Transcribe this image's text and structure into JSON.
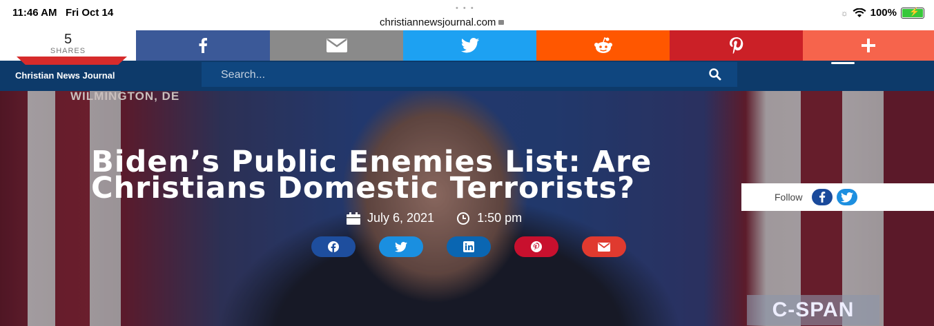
{
  "status": {
    "time": "11:46 AM",
    "day": "Fri Oct 14",
    "url": "christiannewsjournal.com",
    "battery": "100%",
    "dots": "• • •"
  },
  "sharebar": {
    "count": "5",
    "count_label": "SHARES",
    "buttons": [
      {
        "name": "facebook",
        "icon": "facebook-icon",
        "color": "#3b5998"
      },
      {
        "name": "email",
        "icon": "email-icon",
        "color": "#8a8a8a"
      },
      {
        "name": "twitter",
        "icon": "twitter-icon",
        "color": "#1da1f2"
      },
      {
        "name": "reddit",
        "icon": "reddit-icon",
        "color": "#ff5700"
      },
      {
        "name": "pinterest",
        "icon": "pinterest-icon",
        "color": "#cb2027"
      },
      {
        "name": "more",
        "icon": "plus-icon",
        "color": "#f6644c"
      }
    ]
  },
  "nav": {
    "logo_text": "Christian News Journal",
    "search_placeholder": "Search...",
    "bg_color": "#0d3a6a"
  },
  "hero": {
    "location_text": "WILMINGTON, DE",
    "title_line1": "Biden’s Public Enemies List: Are",
    "title_line2": "Christians Domestic Terrorists?",
    "date": "July 6, 2021",
    "time": "1:50 pm",
    "network_logo": "C-SPAN",
    "share_buttons": [
      {
        "name": "facebook",
        "icon": "facebook-icon",
        "color": "#1e4e9e"
      },
      {
        "name": "twitter",
        "icon": "twitter-icon",
        "color": "#1a8fe0"
      },
      {
        "name": "linkedin",
        "icon": "linkedin-icon",
        "color": "#0a66b2"
      },
      {
        "name": "pinterest",
        "icon": "pinterest-icon",
        "color": "#c8102e"
      },
      {
        "name": "email",
        "icon": "email-icon",
        "color": "#e03a2f"
      }
    ]
  },
  "follow": {
    "label": "Follow"
  }
}
